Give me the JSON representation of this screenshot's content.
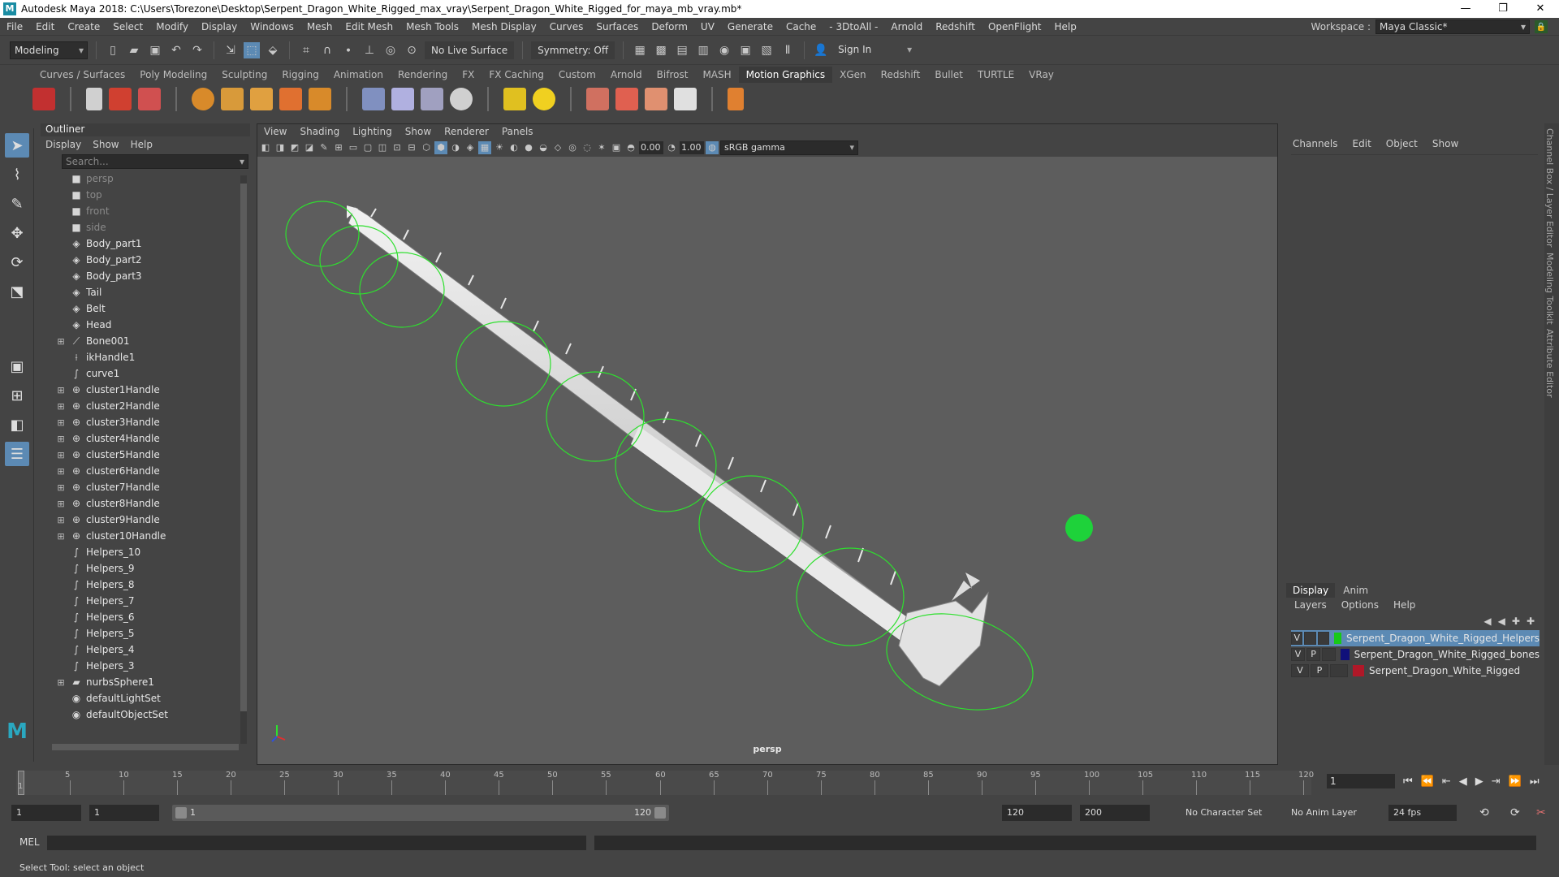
{
  "window": {
    "title": "Autodesk Maya 2018: C:\\Users\\Torezone\\Desktop\\Serpent_Dragon_White_Rigged_max_vray\\Serpent_Dragon_White_Rigged_for_maya_mb_vray.mb*",
    "logo": "M"
  },
  "menus": [
    "File",
    "Edit",
    "Create",
    "Select",
    "Modify",
    "Display",
    "Windows",
    "Mesh",
    "Edit Mesh",
    "Mesh Tools",
    "Mesh Display",
    "Curves",
    "Surfaces",
    "Deform",
    "UV",
    "Generate",
    "Cache",
    "- 3DtoAll -",
    "Arnold",
    "Redshift",
    "OpenFlight",
    "Help"
  ],
  "workspace": {
    "label": "Workspace :",
    "value": "Maya Classic*"
  },
  "status": {
    "mode": "Modeling",
    "live_surface": "No Live Surface",
    "symmetry": "Symmetry: Off",
    "sign_in": "Sign In"
  },
  "shelf_tabs": [
    "Curves / Surfaces",
    "Poly Modeling",
    "Sculpting",
    "Rigging",
    "Animation",
    "Rendering",
    "FX",
    "FX Caching",
    "Custom",
    "Arnold",
    "Bifrost",
    "MASH",
    "Motion Graphics",
    "XGen",
    "Redshift",
    "Bullet",
    "TURTLE",
    "VRay"
  ],
  "shelf_active": "Motion Graphics",
  "outliner": {
    "title": "Outliner",
    "menu": [
      "Display",
      "Show",
      "Help"
    ],
    "search_placeholder": "Search...",
    "items": [
      {
        "label": "persp",
        "icon": "camera-icon",
        "dim": true,
        "expand": ""
      },
      {
        "label": "top",
        "icon": "camera-icon",
        "dim": true,
        "expand": ""
      },
      {
        "label": "front",
        "icon": "camera-icon",
        "dim": true,
        "expand": ""
      },
      {
        "label": "side",
        "icon": "camera-icon",
        "dim": true,
        "expand": ""
      },
      {
        "label": "Body_part1",
        "icon": "mesh-icon",
        "dim": false,
        "expand": ""
      },
      {
        "label": "Body_part2",
        "icon": "mesh-icon",
        "dim": false,
        "expand": ""
      },
      {
        "label": "Body_part3",
        "icon": "mesh-icon",
        "dim": false,
        "expand": ""
      },
      {
        "label": "Tail",
        "icon": "mesh-icon",
        "dim": false,
        "expand": ""
      },
      {
        "label": "Belt",
        "icon": "mesh-icon",
        "dim": false,
        "expand": ""
      },
      {
        "label": "Head",
        "icon": "mesh-icon",
        "dim": false,
        "expand": ""
      },
      {
        "label": "Bone001",
        "icon": "joint-icon",
        "dim": false,
        "expand": "⊞"
      },
      {
        "label": "ikHandle1",
        "icon": "ik-handle-icon",
        "dim": false,
        "expand": ""
      },
      {
        "label": "curve1",
        "icon": "curve-icon",
        "dim": false,
        "expand": ""
      },
      {
        "label": "cluster1Handle",
        "icon": "cluster-icon",
        "dim": false,
        "expand": "⊞"
      },
      {
        "label": "cluster2Handle",
        "icon": "cluster-icon",
        "dim": false,
        "expand": "⊞"
      },
      {
        "label": "cluster3Handle",
        "icon": "cluster-icon",
        "dim": false,
        "expand": "⊞"
      },
      {
        "label": "cluster4Handle",
        "icon": "cluster-icon",
        "dim": false,
        "expand": "⊞"
      },
      {
        "label": "cluster5Handle",
        "icon": "cluster-icon",
        "dim": false,
        "expand": "⊞"
      },
      {
        "label": "cluster6Handle",
        "icon": "cluster-icon",
        "dim": false,
        "expand": "⊞"
      },
      {
        "label": "cluster7Handle",
        "icon": "cluster-icon",
        "dim": false,
        "expand": "⊞"
      },
      {
        "label": "cluster8Handle",
        "icon": "cluster-icon",
        "dim": false,
        "expand": "⊞"
      },
      {
        "label": "cluster9Handle",
        "icon": "cluster-icon",
        "dim": false,
        "expand": "⊞"
      },
      {
        "label": "cluster10Handle",
        "icon": "cluster-icon",
        "dim": false,
        "expand": "⊞"
      },
      {
        "label": "Helpers_10",
        "icon": "curve-icon",
        "dim": false,
        "expand": ""
      },
      {
        "label": "Helpers_9",
        "icon": "curve-icon",
        "dim": false,
        "expand": ""
      },
      {
        "label": "Helpers_8",
        "icon": "curve-icon",
        "dim": false,
        "expand": ""
      },
      {
        "label": "Helpers_7",
        "icon": "curve-icon",
        "dim": false,
        "expand": ""
      },
      {
        "label": "Helpers_6",
        "icon": "curve-icon",
        "dim": false,
        "expand": ""
      },
      {
        "label": "Helpers_5",
        "icon": "curve-icon",
        "dim": false,
        "expand": ""
      },
      {
        "label": "Helpers_4",
        "icon": "curve-icon",
        "dim": false,
        "expand": ""
      },
      {
        "label": "Helpers_3",
        "icon": "curve-icon",
        "dim": false,
        "expand": ""
      },
      {
        "label": "nurbsSphere1",
        "icon": "nurbs-icon",
        "dim": false,
        "expand": "⊞"
      },
      {
        "label": "defaultLightSet",
        "icon": "set-icon",
        "dim": false,
        "expand": ""
      },
      {
        "label": "defaultObjectSet",
        "icon": "set-icon",
        "dim": false,
        "expand": ""
      }
    ]
  },
  "viewport": {
    "menu": [
      "View",
      "Shading",
      "Lighting",
      "Show",
      "Renderer",
      "Panels"
    ],
    "exposure": "0.00",
    "gamma_value": "1.00",
    "color_space": "sRGB gamma",
    "camera": "persp"
  },
  "channel_box": {
    "menu": [
      "Channels",
      "Edit",
      "Object",
      "Show"
    ]
  },
  "side_tabs": [
    "Channel Box / Layer Editor",
    "Modeling Toolkit",
    "Attribute Editor"
  ],
  "layers": {
    "tabs": [
      "Display",
      "Anim"
    ],
    "menu": [
      "Layers",
      "Options",
      "Help"
    ],
    "rows": [
      {
        "v": "V",
        "p": "",
        "name": "Serpent_Dragon_White_Rigged_Helpers",
        "color": "#18c818",
        "selected": true
      },
      {
        "v": "V",
        "p": "P",
        "name": "Serpent_Dragon_White_Rigged_bones",
        "color": "#10107a",
        "selected": false
      },
      {
        "v": "V",
        "p": "P",
        "name": "Serpent_Dragon_White_Rigged",
        "color": "#b01828",
        "selected": false
      }
    ]
  },
  "timeline": {
    "ticks": [
      "5",
      "10",
      "15",
      "20",
      "25",
      "30",
      "35",
      "40",
      "45",
      "50",
      "55",
      "60",
      "65",
      "70",
      "75",
      "80",
      "85",
      "90",
      "95",
      "100",
      "105",
      "110",
      "115",
      "120"
    ],
    "start_tick": "1",
    "current_frame": "1",
    "current_frame_fraction": 0
  },
  "range": {
    "start": "1",
    "anim_start": "1",
    "range_start": "1",
    "range_end": "120",
    "end": "120",
    "anim_end": "200",
    "character_set": "No Character Set",
    "anim_layer": "No Anim Layer",
    "fps": "24 fps"
  },
  "command": {
    "lang": "MEL"
  },
  "help_line": "Select Tool: select an object",
  "colors": {
    "helper_green": "#2ee02e",
    "selection_blue": "#5c8ab4",
    "viewport_bg": "#5d5d5d"
  }
}
